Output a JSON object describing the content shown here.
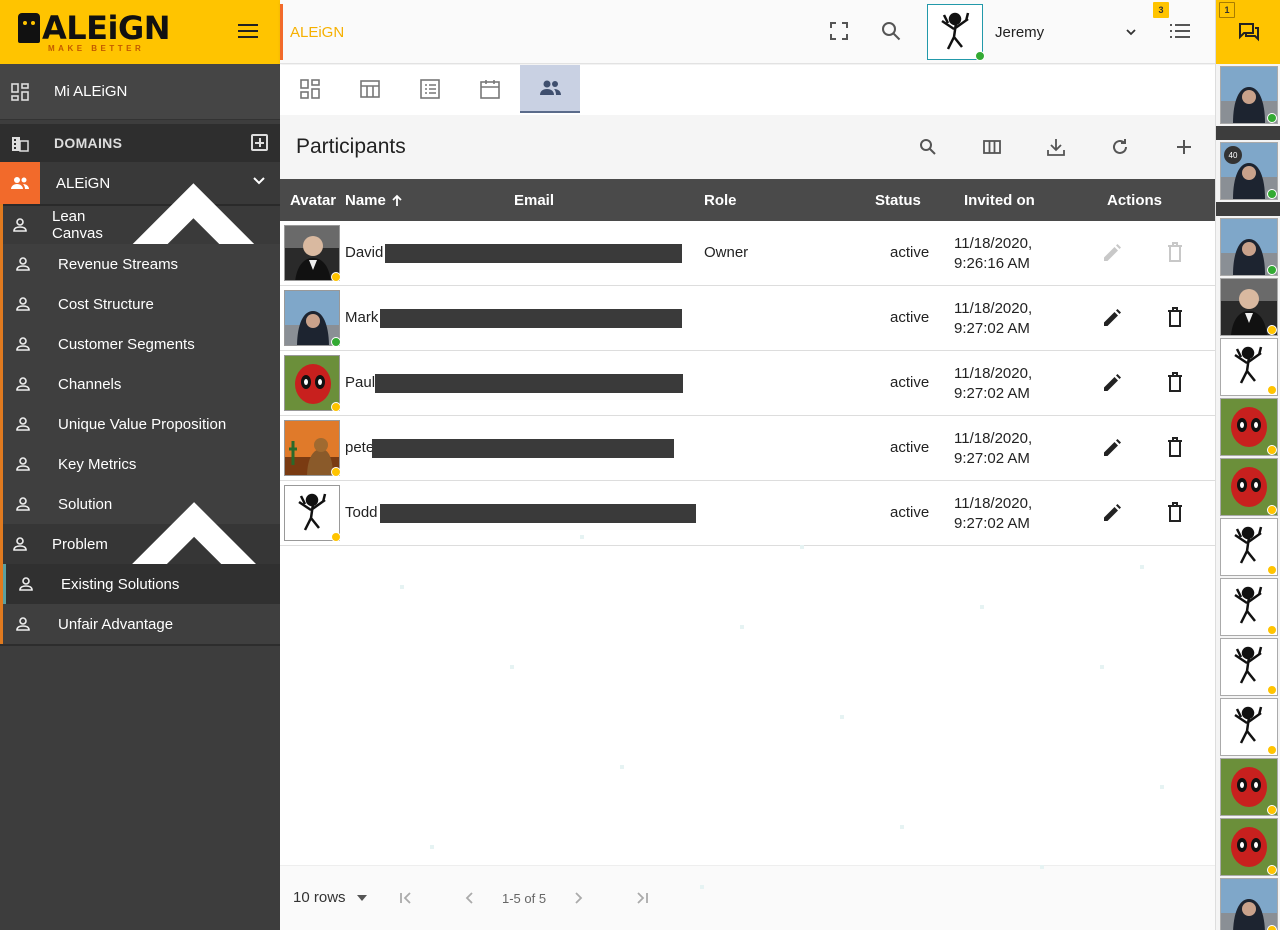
{
  "brand": {
    "logo_text": "ALEiGN",
    "tagline": "MAKE BETTER",
    "accent": "#ffc400",
    "orange": "#f26a2b"
  },
  "sidebar": {
    "mi_label": "Mi ALEiGN",
    "domains_label": "DOMAINS",
    "aleign_label": "ALEiGN",
    "lean_label": "Lean Canvas",
    "items": [
      "Revenue Streams",
      "Cost Structure",
      "Customer Segments",
      "Channels",
      "Unique Value Proposition",
      "Key Metrics",
      "Solution"
    ],
    "problem_label": "Problem",
    "existing_label": "Existing Solutions",
    "unfair_label": "Unfair Advantage"
  },
  "header": {
    "title": "ALEiGN",
    "user_name": "Jeremy",
    "notif_count": "3",
    "chat_count": "1"
  },
  "grid": {
    "title": "Participants",
    "columns": {
      "avatar": "Avatar",
      "name": "Name",
      "email": "Email",
      "role": "Role",
      "status": "Status",
      "invited": "Invited on",
      "actions": "Actions"
    },
    "rows": [
      {
        "name": "David",
        "role": "Owner",
        "status": "active",
        "date": "11/18/2020,",
        "time": "9:26:16 AM",
        "presence": "away"
      },
      {
        "name": "Mark",
        "role": "",
        "status": "active",
        "date": "11/18/2020,",
        "time": "9:27:02 AM",
        "presence": "online"
      },
      {
        "name": "Paul",
        "role": "",
        "status": "active",
        "date": "11/18/2020,",
        "time": "9:27:02 AM",
        "presence": "away"
      },
      {
        "name": "pete",
        "role": "",
        "status": "active",
        "date": "11/18/2020,",
        "time": "9:27:02 AM",
        "presence": "away"
      },
      {
        "name": "Todd",
        "role": "",
        "status": "active",
        "date": "11/18/2020,",
        "time": "9:27:02 AM",
        "presence": "away"
      }
    ]
  },
  "footer": {
    "rows_label": "10 rows",
    "range": "1-5 of 5"
  },
  "rail": {
    "badge_40": "40"
  }
}
